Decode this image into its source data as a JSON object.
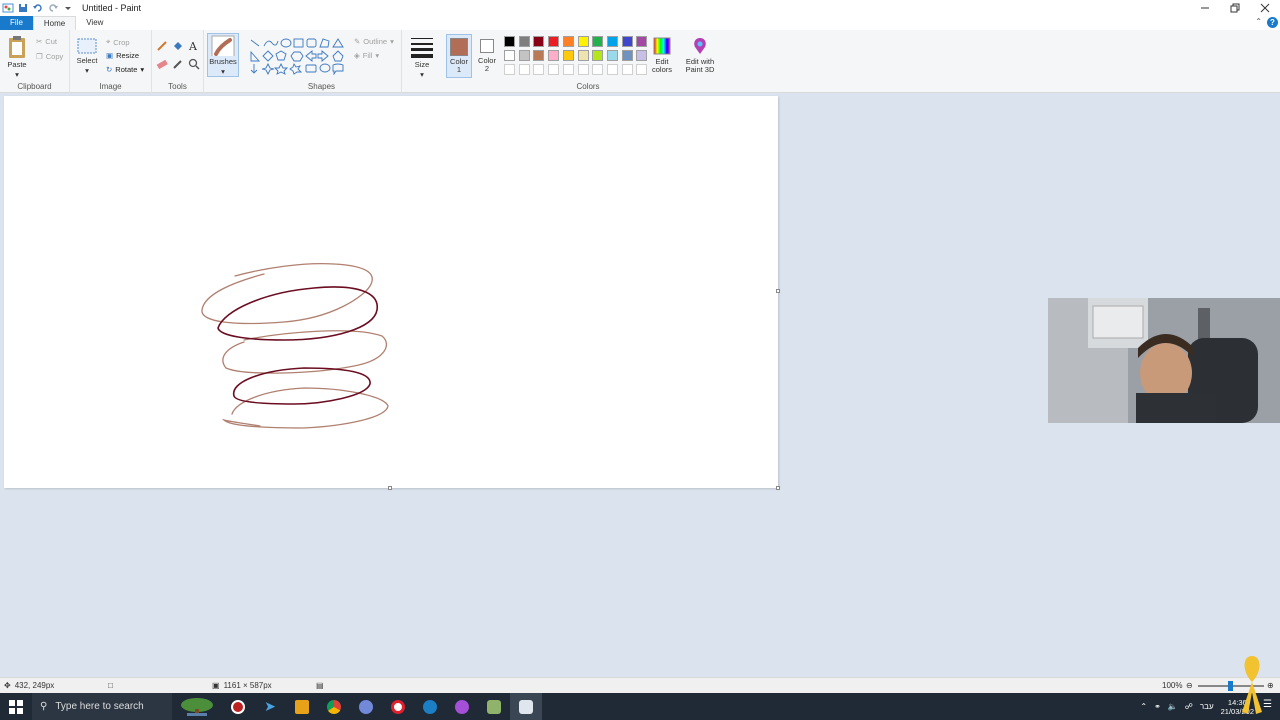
{
  "window": {
    "title": "Untitled - Paint"
  },
  "tabs": {
    "file": "File",
    "home": "Home",
    "view": "View"
  },
  "ribbon": {
    "clipboard": {
      "paste": "Paste",
      "cut": "Cut",
      "copy": "Copy",
      "label": "Clipboard"
    },
    "image": {
      "select": "Select",
      "crop": "Crop",
      "resize": "Resize",
      "rotate": "Rotate",
      "label": "Image"
    },
    "tools": {
      "label": "Tools"
    },
    "brushes": {
      "label": "Brushes"
    },
    "shapes": {
      "outline": "Outline",
      "fill": "Fill",
      "label": "Shapes"
    },
    "size": {
      "label": "Size"
    },
    "color1": {
      "line1": "Color",
      "line2": "1",
      "value": "#b26d56"
    },
    "color2": {
      "line1": "Color",
      "line2": "2",
      "value": "#ffffff"
    },
    "colors": {
      "label": "Colors",
      "edit_line1": "Edit",
      "edit_line2": "colors",
      "row1": [
        "#000000",
        "#7f7f7f",
        "#880015",
        "#ed1c24",
        "#ff7f27",
        "#fff200",
        "#22b14c",
        "#00a2e8",
        "#3f48cc",
        "#a349a4"
      ],
      "row2": [
        "#ffffff",
        "#c3c3c3",
        "#b97a57",
        "#ffaec9",
        "#ffc90e",
        "#efe4b0",
        "#b5e61d",
        "#99d9ea",
        "#7092be",
        "#c8bfe7"
      ]
    },
    "paint3d": {
      "line1": "Edit with",
      "line2": "Paint 3D"
    }
  },
  "drawing": {
    "stroke_tan": "#b08070",
    "stroke_maroon": "#6b0d22"
  },
  "status": {
    "cursor_pos": "432, 249px",
    "canvas_size": "1161 × 587px",
    "zoom": "100%"
  },
  "taskbar": {
    "search_placeholder": "Type here to search",
    "language": "עבר",
    "time": "14:36",
    "date": "21/03/202"
  }
}
